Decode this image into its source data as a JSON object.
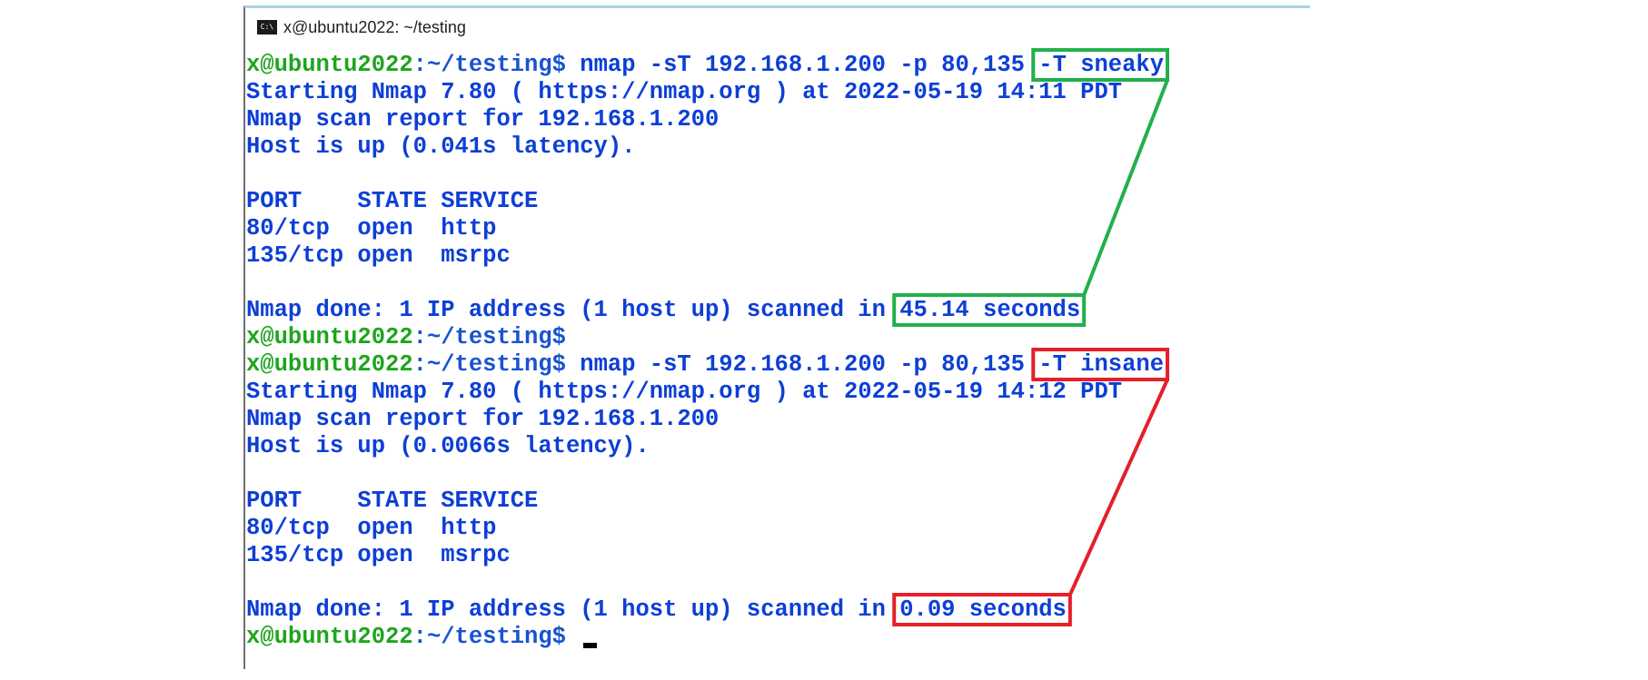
{
  "window": {
    "icon_text": "C:\\",
    "title": "x@ubuntu2022: ~/testing"
  },
  "prompt": {
    "user_host": "x@ubuntu2022",
    "path": ":~/testing",
    "dollar": "$"
  },
  "scan1": {
    "command_prefix": " nmap -sT 192.168.1.200 -p 80,135 ",
    "timing_flag": "-T sneaky",
    "starting": "Starting Nmap 7.80 ( https://nmap.org ) at 2022-05-19 14:11 PDT",
    "report": "Nmap scan report for 192.168.1.200",
    "host_up": "Host is up (0.041s latency).",
    "port_header": "PORT    STATE SERVICE",
    "ports": [
      "80/tcp  open  http",
      "135/tcp open  msrpc"
    ],
    "done_prefix": "Nmap done: 1 IP address (1 host up) scanned in ",
    "duration": "45.14 seconds"
  },
  "scan2": {
    "command_prefix": " nmap -sT 192.168.1.200 -p 80,135 ",
    "timing_flag": "-T insane",
    "starting": "Starting Nmap 7.80 ( https://nmap.org ) at 2022-05-19 14:12 PDT",
    "report": "Nmap scan report for 192.168.1.200",
    "host_up": "Host is up (0.0066s latency).",
    "port_header": "PORT    STATE SERVICE",
    "ports": [
      "80/tcp  open  http",
      "135/tcp open  msrpc"
    ],
    "done_prefix": "Nmap done: 1 IP address (1 host up) scanned in ",
    "duration": "0.09 seconds"
  },
  "colors": {
    "text": "#0d3fd6",
    "prompt_user": "#1ea51e",
    "prompt_path": "#1a53d0",
    "highlight_green": "#22b04b",
    "highlight_red": "#e3202b"
  }
}
